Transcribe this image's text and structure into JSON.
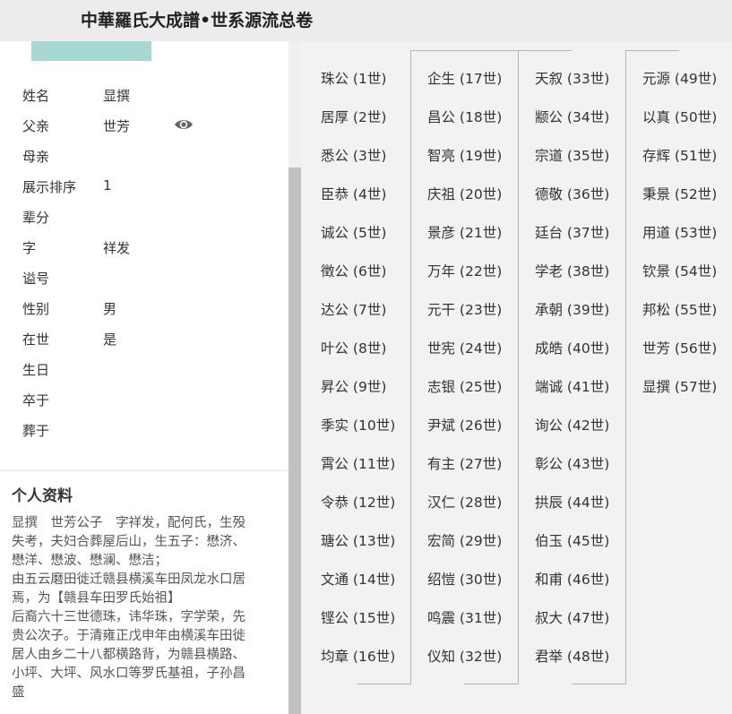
{
  "header": {
    "title": "中華羅氏大成譜•世系源流总卷"
  },
  "person_info": {
    "rows": [
      {
        "label": "姓名",
        "value": "显撰"
      },
      {
        "label": "父亲",
        "value": "世芳"
      },
      {
        "label": "母亲",
        "value": ""
      },
      {
        "label": "展示排序",
        "value": "1"
      },
      {
        "label": "辈分",
        "value": ""
      },
      {
        "label": "字",
        "value": "祥发"
      },
      {
        "label": "谥号",
        "value": ""
      },
      {
        "label": "性别",
        "value": "男"
      },
      {
        "label": "在世",
        "value": "是"
      },
      {
        "label": "生日",
        "value": ""
      },
      {
        "label": "卒于",
        "value": ""
      },
      {
        "label": "葬于",
        "value": ""
      }
    ]
  },
  "profile": {
    "title": "个人资料",
    "lines": [
      "显撰　世芳公子　字祥发，配何氏，生殁",
      "失考，夫妇合葬屋后山，生五子：懋济、",
      "懋洋、懋波、懋澜、懋洁；",
      "由五云磨田徙迁赣县横溪车田凤龙水口居",
      "焉，为【赣县车田罗氏始祖】",
      "后裔六十三世德珠，讳华珠，字学荣，先",
      "贵公次子。于清雍正戊申年由横溪车田徙",
      "居人由乡二十八都横路背，为赣县横路、",
      "小坪、大坪、风水口等罗氏基祖，子孙昌",
      "盛"
    ]
  },
  "generations": [
    [
      "珠公 (1世)",
      "居厚 (2世)",
      "悉公 (3世)",
      "臣恭 (4世)",
      "诚公 (5世)",
      "徵公 (6世)",
      "达公 (7世)",
      "叶公 (8世)",
      "昇公 (9世)",
      "季实 (10世)",
      "霄公 (11世)",
      "令恭 (12世)",
      "瑭公 (13世)",
      "文通 (14世)",
      "铿公 (15世)",
      "均章 (16世)"
    ],
    [
      "企生 (17世)",
      "昌公 (18世)",
      "智亮 (19世)",
      "庆祖 (20世)",
      "景彦 (21世)",
      "万年 (22世)",
      "元干 (23世)",
      "世宪 (24世)",
      "志银 (25世)",
      "尹斌 (26世)",
      "有主 (27世)",
      "汉仁 (28世)",
      "宏简 (29世)",
      "绍愷 (30世)",
      "鸣震 (31世)",
      "仪知 (32世)"
    ],
    [
      "天叙 (33世)",
      "颛公 (34世)",
      "宗道 (35世)",
      "德敬 (36世)",
      "廷台 (37世)",
      "学老 (38世)",
      "承朝 (39世)",
      "成皓 (40世)",
      "端诚 (41世)",
      "询公 (42世)",
      "彰公 (43世)",
      "拱辰 (44世)",
      "伯玉 (45世)",
      "和甫 (46世)",
      "叔大 (47世)",
      "君举 (48世)"
    ],
    [
      "元源 (49世)",
      "以真 (50世)",
      "存辉 (51世)",
      "秉景 (52世)",
      "用道 (53世)",
      "钦景 (54世)",
      "邦松 (55世)",
      "世芳 (56世)",
      "显撰 (57世)"
    ]
  ]
}
